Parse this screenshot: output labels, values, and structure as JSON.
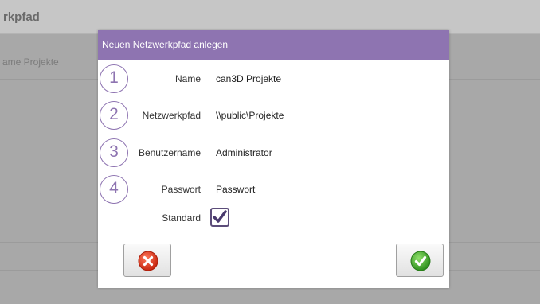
{
  "background": {
    "header_title": "rkpfad",
    "list_item": "ame Projekte"
  },
  "dialog": {
    "title": "Neuen Netzwerkpfad anlegen",
    "fields": [
      {
        "number": "1",
        "label": "Name",
        "value": "can3D Projekte"
      },
      {
        "number": "2",
        "label": "Netzwerkpfad",
        "value": "\\\\public\\Projekte"
      },
      {
        "number": "3",
        "label": "Benutzername",
        "value": "Administrator"
      },
      {
        "number": "4",
        "label": "Passwort",
        "value": "Passwort"
      }
    ],
    "standard_label": "Standard",
    "standard_checked": true,
    "cancel_icon": "red-x-icon",
    "ok_icon": "green-check-icon"
  },
  "colors": {
    "accent": "#8e74b1",
    "checkmark": "#4a3a6e",
    "cancel": "#d9331f",
    "ok": "#3fa52b"
  }
}
